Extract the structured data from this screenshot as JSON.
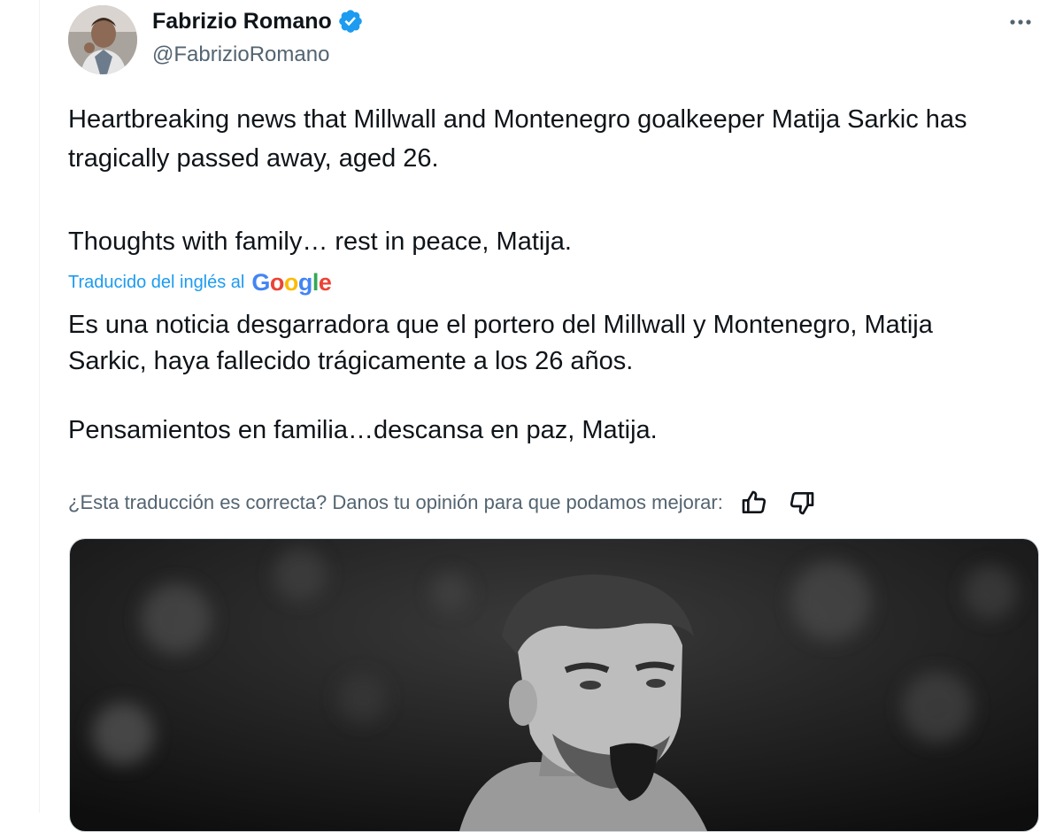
{
  "author": {
    "display_name": "Fabrizio Romano",
    "handle": "@FabrizioRomano",
    "verified": true
  },
  "tweet": {
    "paragraphs": [
      "Heartbreaking news that Millwall and Montenegro goalkeeper Matija Sarkic has tragically passed away, aged 26.",
      "Thoughts with family… rest in peace, Matija."
    ]
  },
  "translation": {
    "label": "Traducido del inglés al",
    "provider_letters": [
      "G",
      "o",
      "o",
      "g",
      "l",
      "e"
    ],
    "paragraphs": [
      "Es una noticia desgarradora que el portero del Millwall y Montenegro, Matija Sarkic, haya fallecido trágicamente a los 26 años.",
      "Pensamientos en familia…descansa en paz, Matija."
    ],
    "feedback_prompt": "¿Esta traducción es correcta? Danos tu opinión para que podamos mejorar:"
  },
  "icons": {
    "more": "more-icon",
    "verified": "verified-badge-icon",
    "thumbs_up": "thumbs-up-icon",
    "thumbs_down": "thumbs-down-icon"
  },
  "colors": {
    "text": "#0f1419",
    "secondary": "#536471",
    "accent": "#1d9bf0",
    "google_blue": "#4285f4",
    "google_red": "#ea4335",
    "google_yellow": "#fbbc05",
    "google_green": "#34a853"
  }
}
